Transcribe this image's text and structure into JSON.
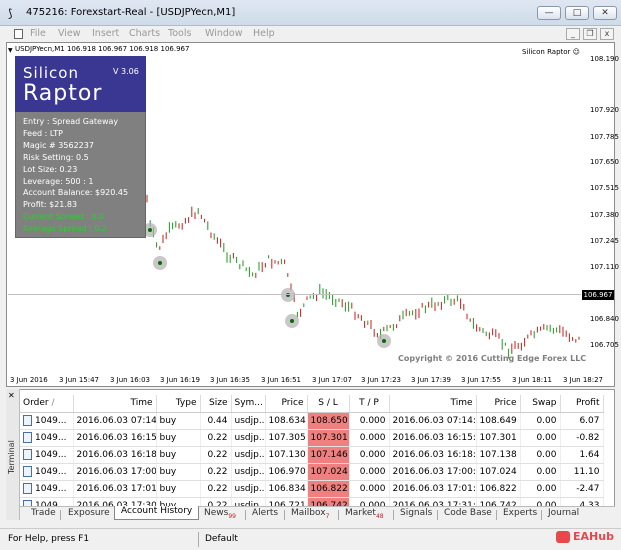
{
  "window": {
    "title": "475216: Forexstart-Real - [USDJPYecn,M1]"
  },
  "menu": [
    "File",
    "View",
    "Insert",
    "Charts",
    "Tools",
    "Window",
    "Help"
  ],
  "chart": {
    "header": "USDJPYecn,M1  106.918 106.967 106.918 106.967",
    "ea_name": "Silicon Raptor",
    "copyright": "Copyright © 2016 Cutting Edge Forex LLC",
    "current_price": "106.967",
    "y_ticks": [
      "108.190",
      "107.920",
      "107.785",
      "107.650",
      "107.515",
      "107.380",
      "107.245",
      "107.110",
      "106.840",
      "106.705"
    ],
    "x_ticks": [
      "3 Jun 2016",
      "3 Jun 15:47",
      "3 Jun 16:03",
      "3 Jun 16:19",
      "3 Jun 16:35",
      "3 Jun 16:51",
      "3 Jun 17:07",
      "3 Jun 17:23",
      "3 Jun 17:39",
      "3 Jun 17:55",
      "3 Jun 18:11",
      "3 Jun 18:27"
    ]
  },
  "panel": {
    "logo_top": "Silicon",
    "logo_bottom": "Raptor",
    "version": "V 3.06",
    "lines": [
      "Entry : Spread Gateway",
      "Feed : LTP",
      "Magic # 3562237",
      "Risk Setting: 0.5",
      "Lot Size: 0.23",
      "Leverage: 500 : 1",
      "Account Balance: $920.45",
      "Profit: $21.83"
    ],
    "green_lines": [
      "Current Spread : 0.0",
      "Average Spread : 0.2"
    ]
  },
  "terminal": {
    "side_label": "Terminal",
    "columns": [
      "Order",
      "Time",
      "Type",
      "Size",
      "Sym...",
      "Price",
      "S / L",
      "T / P",
      "Time",
      "Price",
      "Swap",
      "Profit"
    ],
    "rows": [
      [
        "1049...",
        "2016.06.03 07:14:09",
        "buy",
        "0.44",
        "usdjp...",
        "108.634",
        "108.650",
        "0.000",
        "2016.06.03 07:14:22",
        "108.649",
        "0.00",
        "6.07"
      ],
      [
        "1049...",
        "2016.06.03 16:15:41",
        "buy",
        "0.22",
        "usdjp...",
        "107.305",
        "107.301",
        "0.000",
        "2016.06.03 16:15:50",
        "107.301",
        "0.00",
        "-0.82"
      ],
      [
        "1049...",
        "2016.06.03 16:18:25",
        "buy",
        "0.22",
        "usdjp...",
        "107.130",
        "107.146",
        "0.000",
        "2016.06.03 16:18:28",
        "107.138",
        "0.00",
        "1.64"
      ],
      [
        "1049...",
        "2016.06.03 17:00:05",
        "buy",
        "0.22",
        "usdjp...",
        "106.970",
        "107.024",
        "0.000",
        "2016.06.03 17:00:08",
        "107.024",
        "0.00",
        "11.10"
      ],
      [
        "1049...",
        "2016.06.03 17:01:46",
        "buy",
        "0.22",
        "usdjp...",
        "106.834",
        "106.822",
        "0.000",
        "2016.06.03 17:01:57",
        "106.822",
        "0.00",
        "-2.47"
      ],
      [
        "1049...",
        "2016.06.03 17:30:56",
        "buy",
        "0.22",
        "usdjp...",
        "106.721",
        "106.742",
        "0.000",
        "2016.06.03 17:31:00",
        "106.742",
        "0.00",
        "4.33"
      ]
    ],
    "tabs": [
      "Trade",
      "Exposure",
      "Account History",
      "News",
      "Alerts",
      "Mailbox",
      "Market",
      "Signals",
      "Code Base",
      "Experts",
      "Journal"
    ],
    "tab_badges": {
      "News": "99",
      "Mailbox": "7",
      "Market": "48"
    },
    "active_tab": "Account History"
  },
  "status": {
    "left": "For Help, press F1",
    "profile": "Default"
  },
  "watermark": "EAHub"
}
